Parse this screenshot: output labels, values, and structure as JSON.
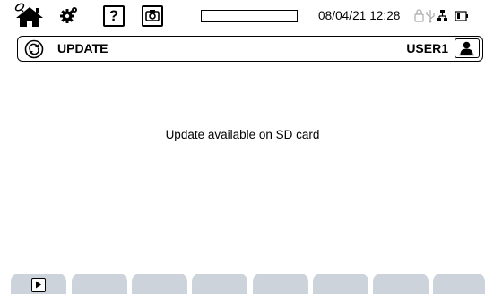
{
  "status_bar": {
    "icons": [
      "home-icon",
      "gear-icon",
      "help-icon",
      "camera-icon",
      "lock-icon",
      "usb-icon",
      "network-icon",
      "battery-icon"
    ],
    "help_label": "?",
    "storage_progress": 0.0,
    "datetime": "08/04/21 12:28"
  },
  "header": {
    "title": "UPDATE",
    "title_icon": "update-icon",
    "user": "USER1",
    "user_icon": "user-icon"
  },
  "main": {
    "message": "Update available on SD card"
  },
  "function_keys": {
    "count": 8,
    "first_icon": "play-icon"
  },
  "colors": {
    "background": "#ffffff",
    "function_key": "#cdd3db",
    "border": "#000000"
  }
}
